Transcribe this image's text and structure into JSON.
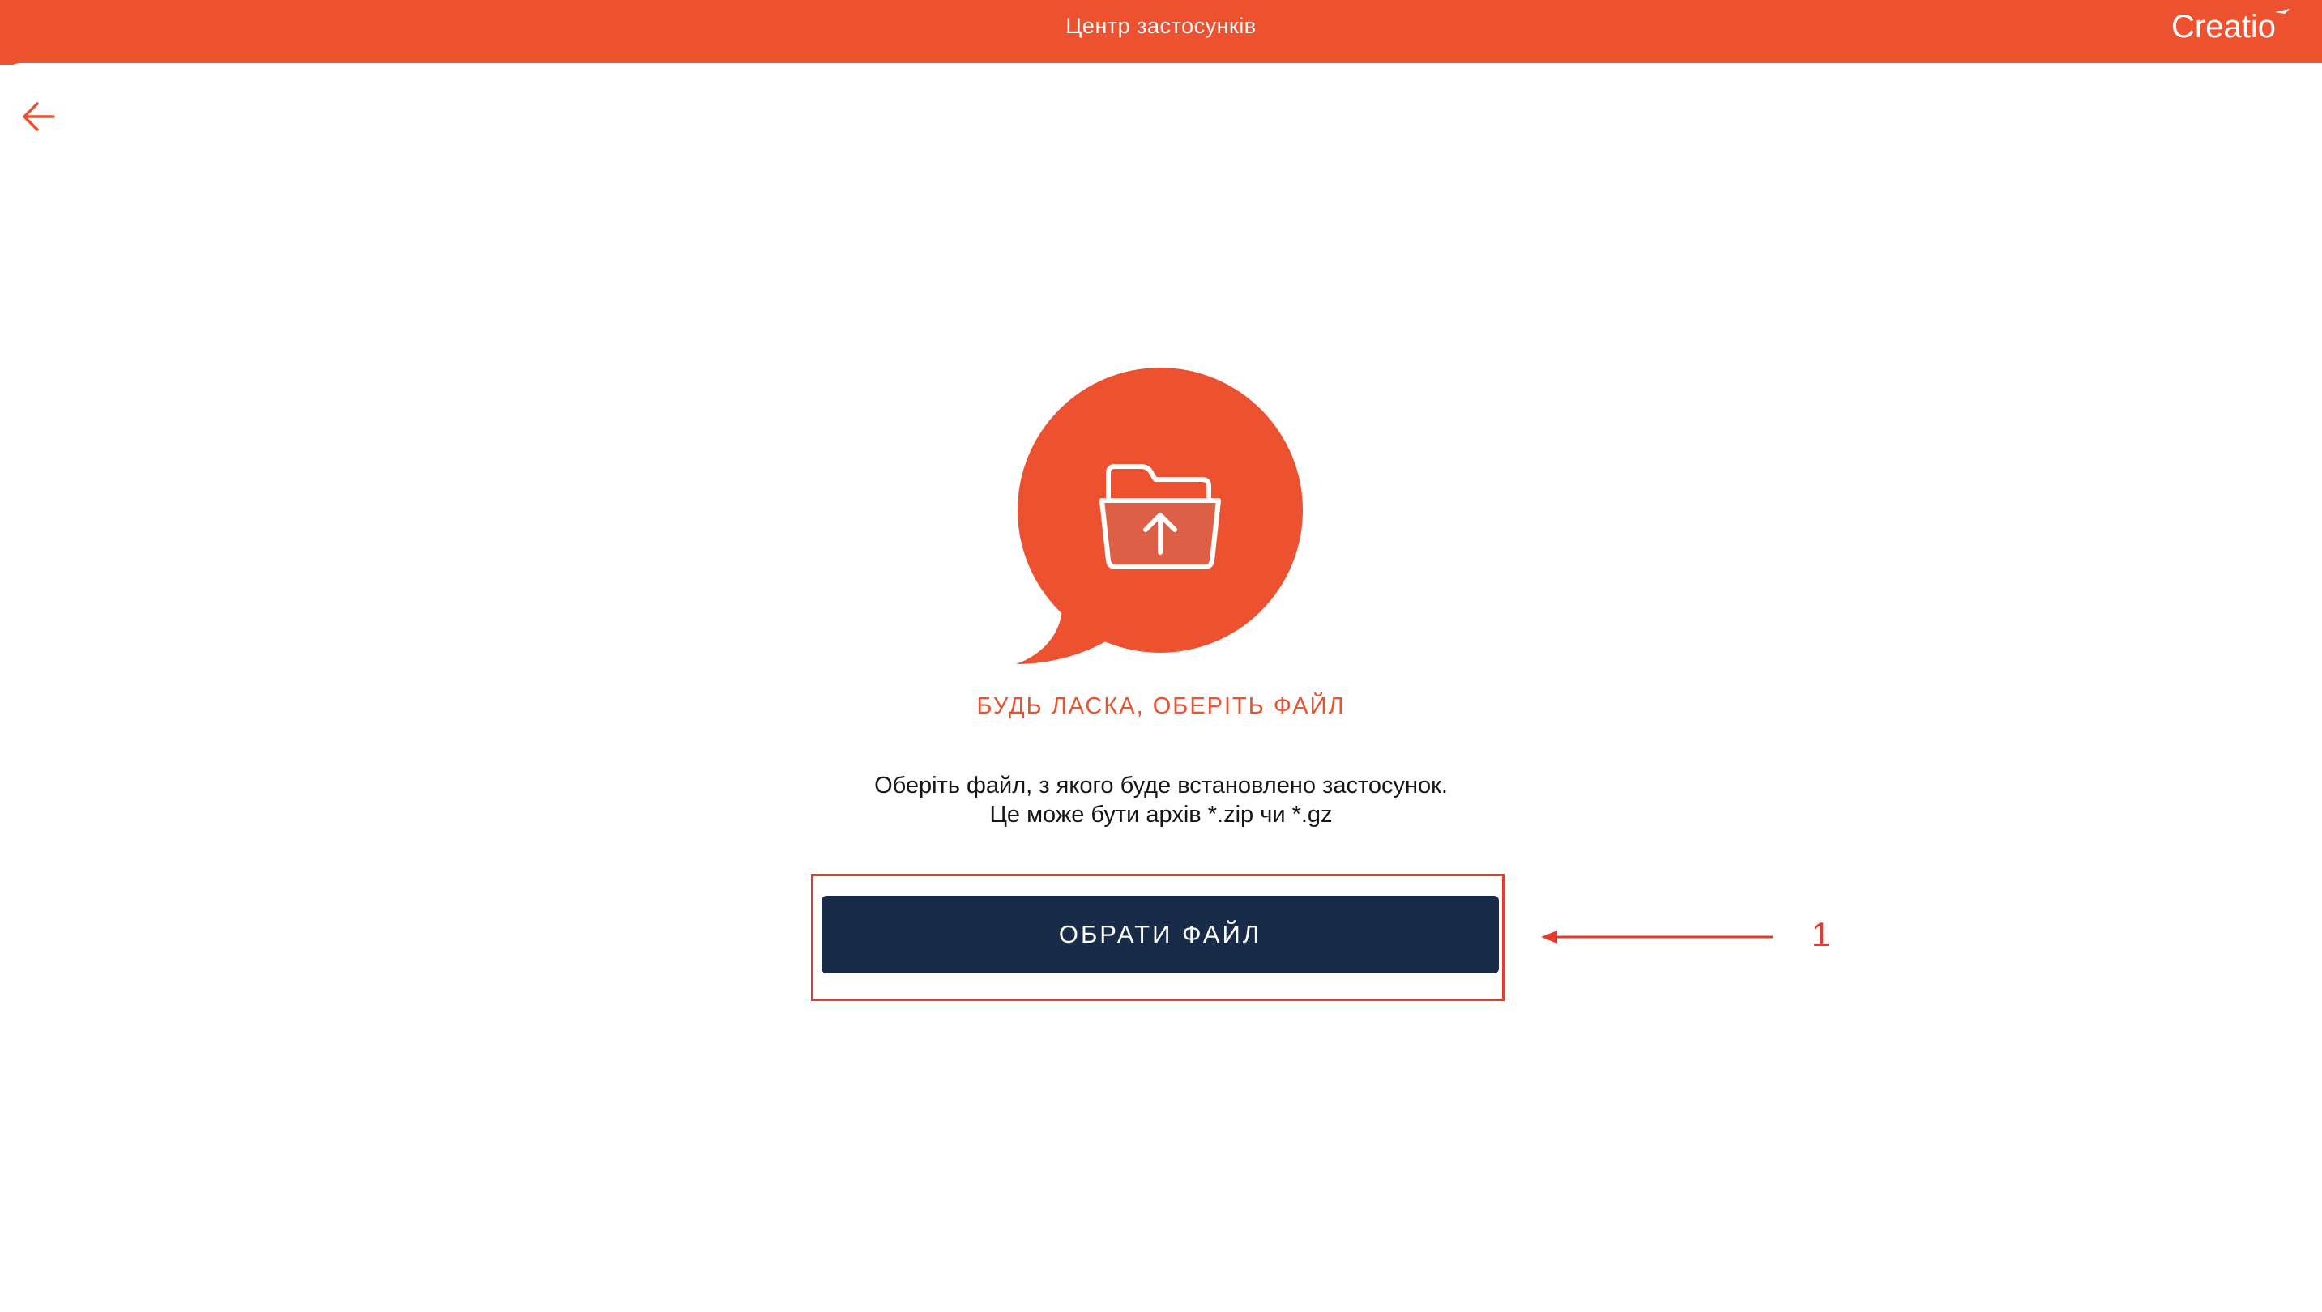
{
  "header": {
    "title": "Центр застосунків",
    "brand": "Creatio"
  },
  "navigation": {
    "back_icon": "arrow-left-icon"
  },
  "upload_prompt": {
    "illustration_icon": "folder-upload-icon",
    "heading": "БУДЬ ЛАСКА, ОБЕРІТЬ ФАЙЛ",
    "description_line1": "Оберіть файл, з якого буде встановлено застосунок.",
    "description_line2": "Це може бути архів *.zip чи *.gz",
    "select_button_label": "ОБРАТИ ФАЙЛ"
  },
  "annotation": {
    "number": "1"
  },
  "colors": {
    "accent": "#ec522f",
    "button": "#182b49",
    "annotation": "#e8392a",
    "text": "#161616"
  }
}
